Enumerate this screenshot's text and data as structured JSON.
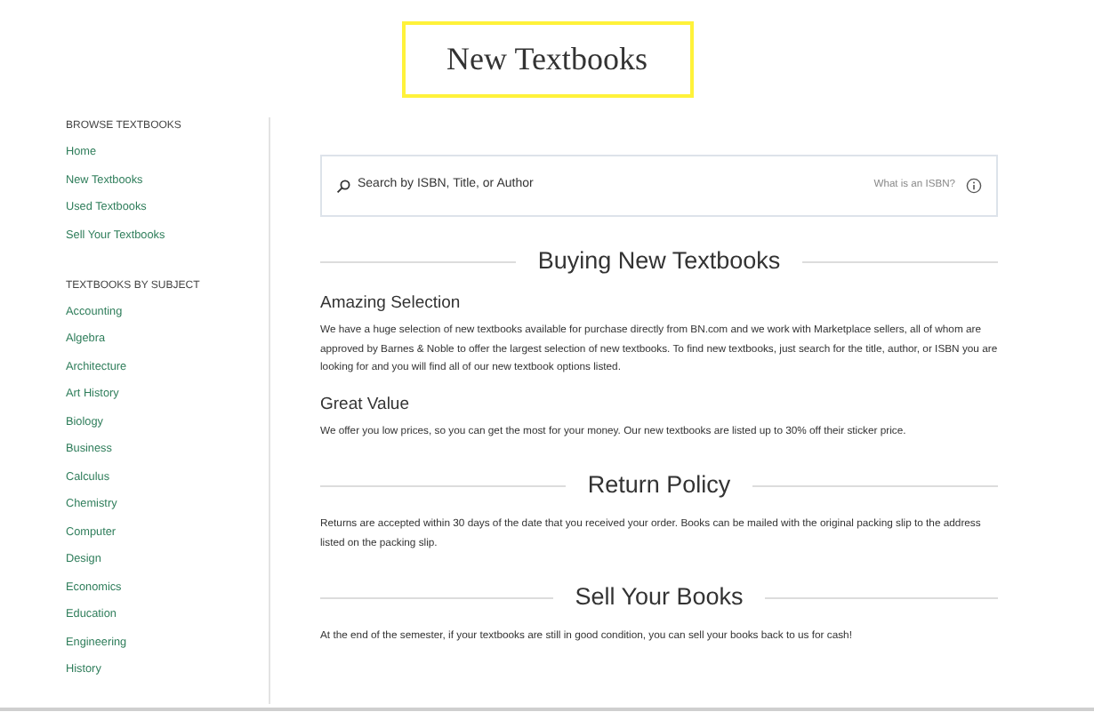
{
  "page_title": "New Textbooks",
  "sidebar": [
    {
      "heading": "BROWSE TEXTBOOKS",
      "links": [
        "Home",
        "New Textbooks",
        "Used Textbooks",
        "Sell Your Textbooks"
      ]
    },
    {
      "heading": "TEXTBOOKS BY SUBJECT",
      "links": [
        "Accounting",
        "Algebra",
        "Architecture",
        "Art History",
        "Biology",
        "Business",
        "Calculus",
        "Chemistry",
        "Computer",
        "Design",
        "Economics",
        "Education",
        "Engineering",
        "History"
      ]
    }
  ],
  "search": {
    "placeholder": "Search by ISBN, Title, or Author",
    "help_link": "What is an ISBN?"
  },
  "content": [
    {
      "kind": "heading",
      "text": "Buying New Textbooks"
    },
    {
      "kind": "subheading",
      "text": "Amazing Selection"
    },
    {
      "kind": "paragraph",
      "text": "We have a huge selection of new textbooks available for purchase directly from BN.com and we work with Marketplace sellers, all of whom are approved by Barnes & Noble to offer the largest selection of new textbooks. To find new textbooks, just search for the title, author, or ISBN you are looking for and you will find all of our new textbook options listed."
    },
    {
      "kind": "subheading",
      "text": "Great Value"
    },
    {
      "kind": "paragraph",
      "text": "We offer you low prices, so you can get the most for your money. Our new textbooks are listed up to 30% off their sticker price."
    },
    {
      "kind": "heading",
      "text": "Return Policy"
    },
    {
      "kind": "paragraph",
      "text": "Returns are accepted within 30 days of the date that you received your order. Books can be mailed with the original packing slip to the address listed on the packing slip."
    },
    {
      "kind": "heading",
      "text": "Sell Your Books"
    },
    {
      "kind": "paragraph",
      "text": "At the end of the semester, if your textbooks are still in good condition, you can sell your books back to us for cash!"
    }
  ]
}
